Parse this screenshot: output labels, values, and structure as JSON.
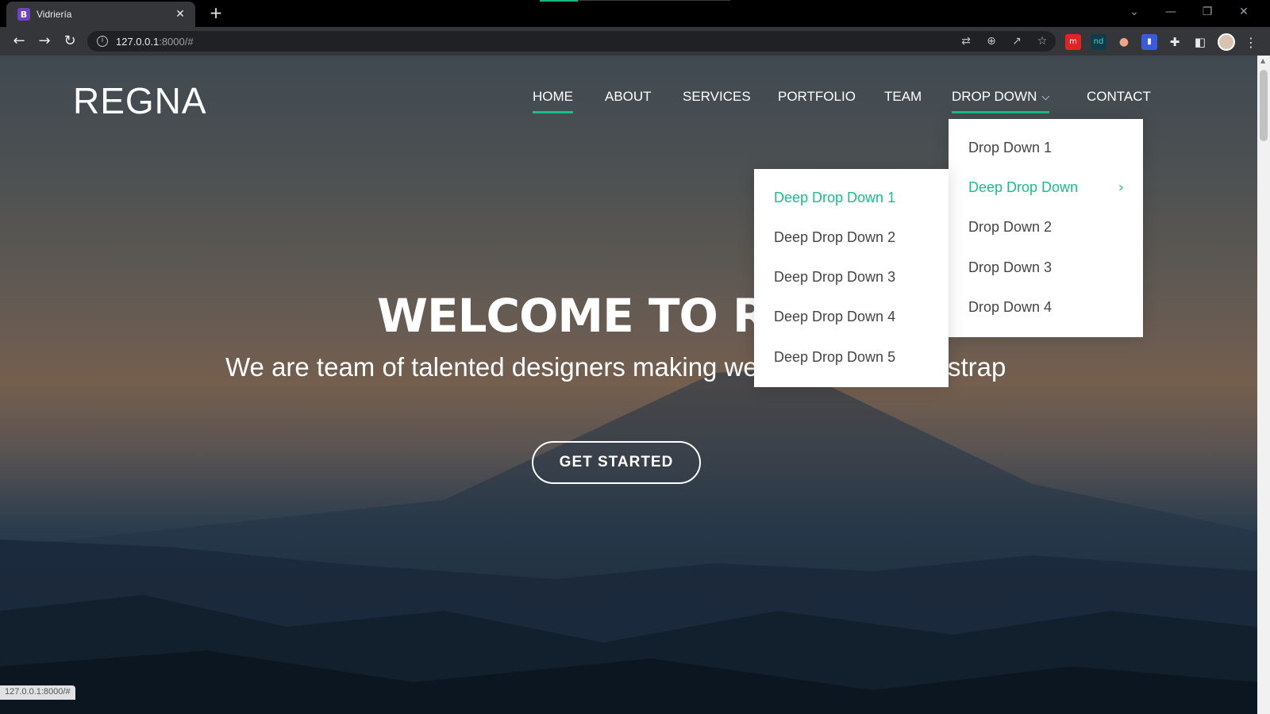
{
  "browser": {
    "tab_title": "Vidriería",
    "tab_favicon_letter": "B",
    "url_host": "127.0.0.1",
    "url_rest": ":8000/#",
    "status_url": "127.0.0.1:8000/#"
  },
  "site": {
    "logo": "REGNA",
    "nav": {
      "home": "HOME",
      "about": "ABOUT",
      "services": "SERVICES",
      "portfolio": "PORTFOLIO",
      "team": "TEAM",
      "dropdown": "DROP DOWN",
      "contact": "CONTACT"
    },
    "dropdown_items": [
      "Drop Down 1",
      "Deep Drop Down",
      "Drop Down 2",
      "Drop Down 3",
      "Drop Down 4"
    ],
    "deep_dropdown_items": [
      "Deep Drop Down 1",
      "Deep Drop Down 2",
      "Deep Drop Down 3",
      "Deep Drop Down 4",
      "Deep Drop Down 5"
    ],
    "hero": {
      "title": "WELCOME TO RE",
      "subtitle": "We are team of talented designers making we",
      "subtitle_tail": "strap",
      "cta": "GET STARTED"
    }
  },
  "colors": {
    "accent": "#1bbd8b"
  }
}
